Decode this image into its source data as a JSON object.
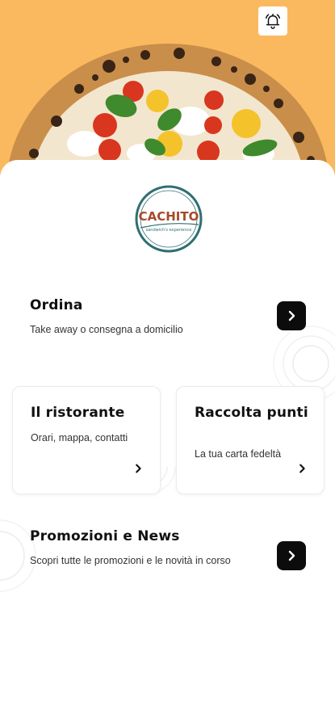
{
  "header": {
    "notification_icon": "bell-icon",
    "hero_image": "pizza-margherita-photo"
  },
  "logo": {
    "brand": "CACHITO",
    "tagline": "sandwich's experience"
  },
  "order": {
    "title": "Ordina",
    "subtitle": "Take away o consegna a domicilio",
    "arrow_icon": "chevron-right-icon"
  },
  "tiles": [
    {
      "title": "Il ristorante",
      "subtitle": "Orari, mappa, contatti",
      "arrow_icon": "chevron-right-icon"
    },
    {
      "title": "Raccolta punti",
      "subtitle": "La tua carta fedeltà",
      "arrow_icon": "chevron-right-icon"
    }
  ],
  "promo": {
    "title": "Promozioni e News",
    "subtitle": "Scopri tutte le promozioni e le novità in corso",
    "arrow_icon": "chevron-right-icon"
  },
  "colors": {
    "hero_background": "#fbb95f",
    "logo_ring": "#2f6f73",
    "logo_text": "#a54a2a",
    "button": "#0c0c0c"
  }
}
